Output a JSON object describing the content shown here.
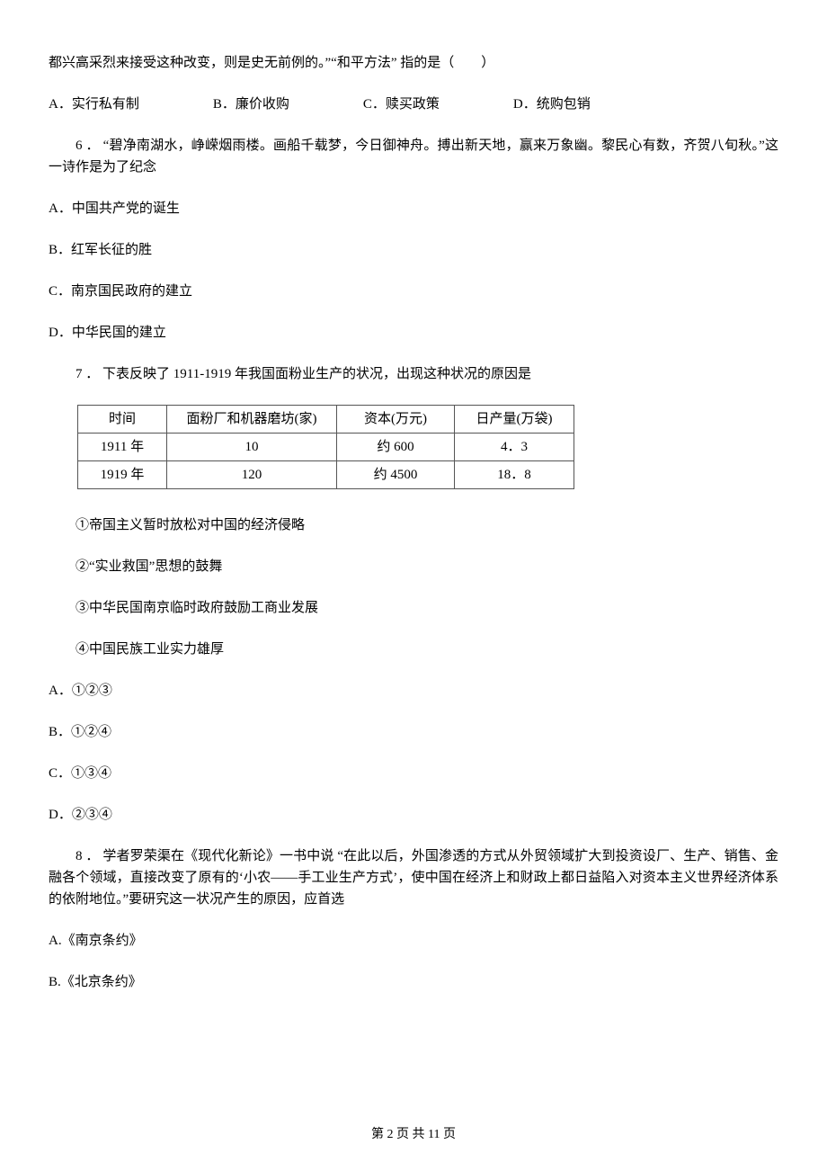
{
  "q5": {
    "fragment": "都兴高采烈来接受这种改变，则是史无前例的。”“和平方法”  指的是（　　）",
    "options": {
      "a": "A．实行私有制",
      "b": "B．廉价收购",
      "c": "C．赎买政策",
      "d": "D．统购包销"
    }
  },
  "q6": {
    "stem": "6 ． “碧净南湖水，峥嵘烟雨楼。画船千载梦，今日御神舟。搏出新天地，赢来万象幽。黎民心有数，齐贺八旬秋。”这一诗作是为了纪念",
    "options": {
      "a": "A．中国共产党的诞生",
      "b": "B．红军长征的胜",
      "c": "C．南京国民政府的建立",
      "d": "D．中华民国的建立"
    }
  },
  "q7": {
    "stem": "7 ． 下表反映了 1911-1919 年我国面粉业生产的状况，出现这种状况的原因是",
    "table": {
      "headers": [
        "时间",
        "面粉厂和机器磨坊(家)",
        "资本(万元)",
        "日产量(万袋)"
      ],
      "rows": [
        [
          "1911 年",
          "10",
          "约 600",
          "4．3"
        ],
        [
          "1919 年",
          "120",
          "约 4500",
          "18．8"
        ]
      ]
    },
    "conditions": {
      "c1": "①帝国主义暂时放松对中国的经济侵略",
      "c2": "②“实业救国”思想的鼓舞",
      "c3": "③中华民国南京临时政府鼓励工商业发展",
      "c4": "④中国民族工业实力雄厚"
    },
    "options": {
      "a": "A．①②③",
      "b": "B．①②④",
      "c": "C．①③④",
      "d": "D．②③④"
    }
  },
  "q8": {
    "stem": "8 ． 学者罗荣渠在《现代化新论》一书中说 “在此以后，外国渗透的方式从外贸领域扩大到投资设厂、生产、销售、金融各个领域，直接改变了原有的‘小农——手工业生产方式’，使中国在经济上和财政上都日益陷入对资本主义世界经济体系的依附地位。”要研究这一状况产生的原因，应首选",
    "options": {
      "a": "A.《南京条约》",
      "b": "B.《北京条约》"
    }
  },
  "footer": {
    "text": "第 2 页 共 11 页"
  }
}
